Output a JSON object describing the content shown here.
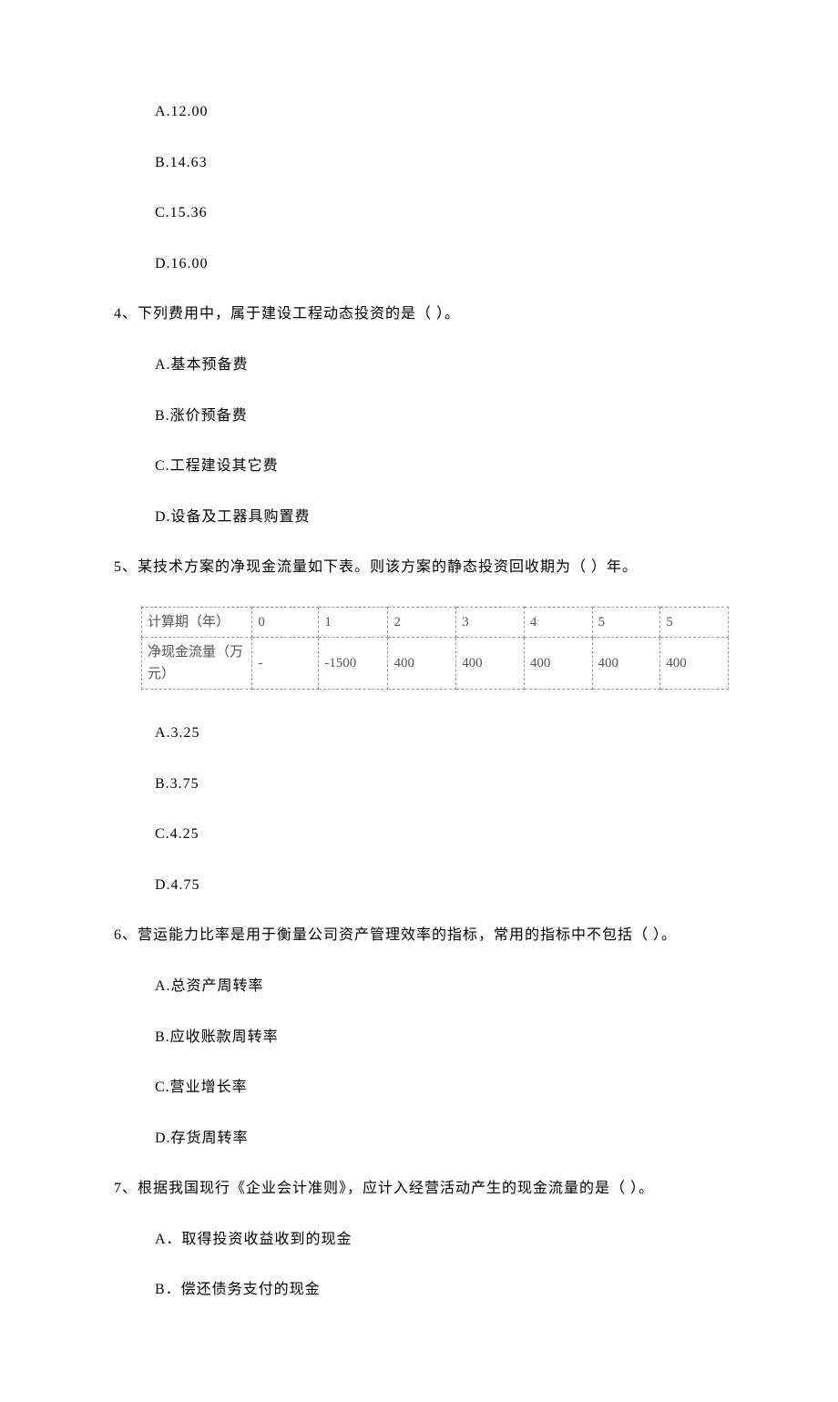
{
  "q3": {
    "options": {
      "a": "A.12.00",
      "b": "B.14.63",
      "c": "C.15.36",
      "d": "D.16.00"
    }
  },
  "q4": {
    "text": "4、下列费用中，属于建设工程动态投资的是（   ）。",
    "options": {
      "a": "A.基本预备费",
      "b": "B.涨价预备费",
      "c": "C.工程建设其它费",
      "d": "D.设备及工器具购置费"
    }
  },
  "q5": {
    "text": "5、某技术方案的净现金流量如下表。则该方案的静态投资回收期为（   ）年。",
    "table": {
      "row1_label": "计算期（年）",
      "row1": [
        "0",
        "1",
        "2",
        "3",
        "4",
        "5",
        "5"
      ],
      "row2_label": "净现金流量（万元）",
      "row2": [
        "-",
        "-1500",
        "400",
        "400",
        "400",
        "400",
        "400"
      ]
    },
    "options": {
      "a": "A.3.25",
      "b": "B.3.75",
      "c": "C.4.25",
      "d": "D.4.75"
    }
  },
  "q6": {
    "text": "6、营运能力比率是用于衡量公司资产管理效率的指标，常用的指标中不包括（   ）。",
    "options": {
      "a": "A.总资产周转率",
      "b": "B.应收账款周转率",
      "c": "C.营业增长率",
      "d": "D.存货周转率"
    }
  },
  "q7": {
    "text": "7、根据我国现行《企业会计准则》，应计入经营活动产生的现金流量的是（    ）。",
    "options": {
      "a": "A．取得投资收益收到的现金",
      "b": "B．偿还债务支付的现金"
    }
  }
}
